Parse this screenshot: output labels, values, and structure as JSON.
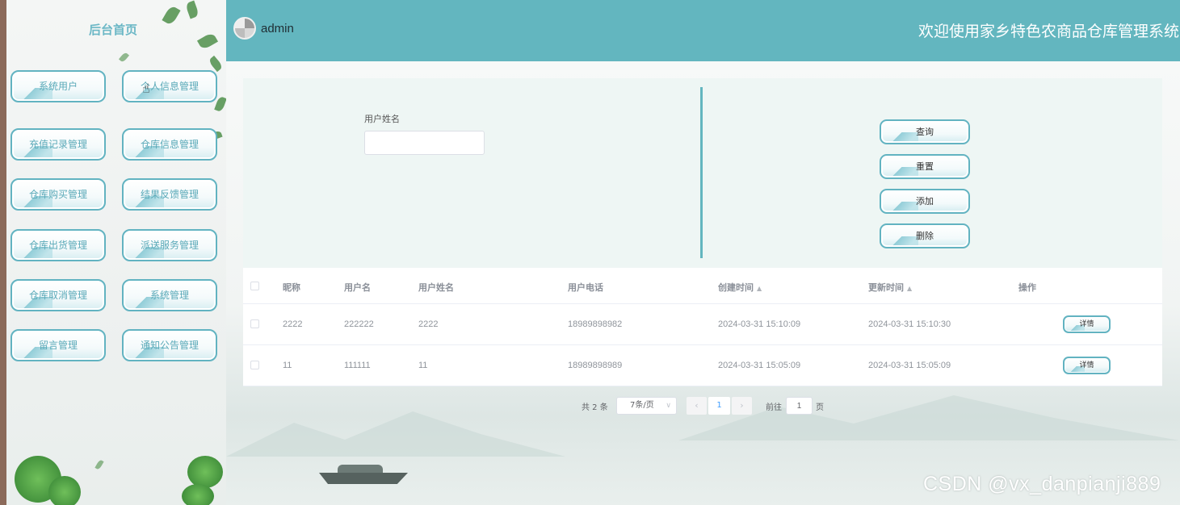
{
  "sidebar": {
    "title": "后台首页",
    "items": [
      {
        "label": "系统用户"
      },
      {
        "label": "个人信息管理"
      },
      {
        "label": "充值记录管理"
      },
      {
        "label": "仓库信息管理"
      },
      {
        "label": "仓库购买管理"
      },
      {
        "label": "结果反馈管理"
      },
      {
        "label": "仓库出货管理"
      },
      {
        "label": "派送服务管理"
      },
      {
        "label": "仓库取消管理"
      },
      {
        "label": "系统管理"
      },
      {
        "label": "留言管理"
      },
      {
        "label": "通知公告管理"
      }
    ]
  },
  "header": {
    "username": "admin",
    "welcome": "欢迎使用家乡特色农商品仓库管理系统"
  },
  "search": {
    "label": "用户姓名",
    "value": "",
    "placeholder": "",
    "buttons": {
      "query": "查询",
      "reset": "重置",
      "add": "添加",
      "delete": "删除"
    }
  },
  "table": {
    "columns": {
      "nickname": "昵称",
      "username": "用户名",
      "realname": "用户姓名",
      "phone": "用户电话",
      "created": "创建时间",
      "updated": "更新时间",
      "actions": "操作"
    },
    "rows": [
      {
        "nickname": "2222",
        "username": "222222",
        "realname": "2222",
        "phone": "18989898982",
        "created": "2024-03-31 15:10:09",
        "updated": "2024-03-31 15:10:30",
        "action": "详情"
      },
      {
        "nickname": "11",
        "username": "111111",
        "realname": "11",
        "phone": "18989898989",
        "created": "2024-03-31 15:05:09",
        "updated": "2024-03-31 15:05:09",
        "action": "详情"
      }
    ]
  },
  "pagination": {
    "total": "共 2 条",
    "page_size": "7条/页",
    "current_page": "1",
    "goto_label": "前往",
    "goto_value": "1",
    "goto_suffix": "页"
  },
  "watermark": "CSDN @vx_danpianji889",
  "icons": {
    "avatar": "avatar-icon",
    "sort": "sort-icon",
    "prev": "chevron-left-icon",
    "next": "chevron-right-icon",
    "dropdown": "chevron-down-icon",
    "cursor": "hand-cursor-icon"
  },
  "colors": {
    "header": "#63b6bf",
    "accent": "#62b3c1",
    "sidebar_text": "#5aa9b8",
    "page_active": "#409eff"
  }
}
